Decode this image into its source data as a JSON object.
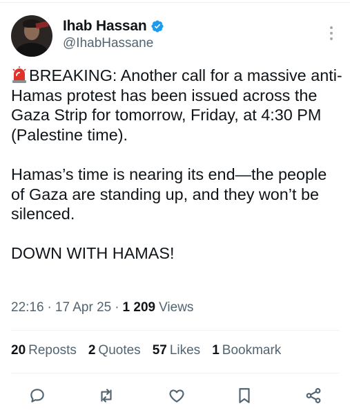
{
  "author": {
    "display_name": "Ihab Hassan",
    "handle": "@IhabHassane",
    "verified": true
  },
  "tweet": {
    "emoji": "siren",
    "paragraphs": [
      "BREAKING: Another call for a massive anti-Hamas protest has been issued across the Gaza Strip for tomorrow, Friday, at 4:30 PM (Palestine time).",
      "Hamas’s time is nearing its end—the people of Gaza are standing up, and they won’t be silenced.",
      "DOWN WITH HAMAS!"
    ],
    "time": "22:16",
    "date": "17 Apr 25",
    "views_count": "1 209",
    "views_label": "Views",
    "separator": "·"
  },
  "stats": [
    {
      "count": "20",
      "label": "Reposts"
    },
    {
      "count": "2",
      "label": "Quotes"
    },
    {
      "count": "57",
      "label": "Likes"
    },
    {
      "count": "1",
      "label": "Bookmark"
    }
  ],
  "actions": [
    "reply-icon",
    "repost-icon",
    "like-icon",
    "bookmark-icon",
    "share-icon"
  ],
  "colors": {
    "text": "#0f1419",
    "secondary": "#536471",
    "verified": "#1d9bf0",
    "divider": "#eff3f4"
  }
}
